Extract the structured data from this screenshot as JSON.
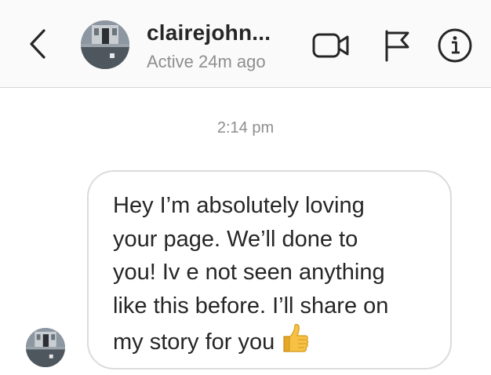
{
  "header": {
    "back_icon": "chevron-left-icon",
    "username": "clairejohn...",
    "status": "Active 24m ago",
    "actions": [
      {
        "name": "video-call",
        "icon": "video-camera-icon"
      },
      {
        "name": "report",
        "icon": "flag-icon"
      },
      {
        "name": "info",
        "icon": "info-icon"
      }
    ]
  },
  "thread": {
    "timestamp": "2:14 pm",
    "messages": [
      {
        "sender": "clairejohn...",
        "text": "Hey I’m absolutely loving\nyour page. We’ll done to\nyou! Iv e not seen anything\nlike this before. I’ll share on\nmy story for you",
        "emoji": "thumbs-up-icon"
      }
    ]
  },
  "colors": {
    "header_bg": "#fafafa",
    "text_primary": "#262626",
    "text_secondary": "#8e8e8e",
    "bubble_border": "#dbdbdb",
    "emoji_yellow": "#f7c244"
  }
}
